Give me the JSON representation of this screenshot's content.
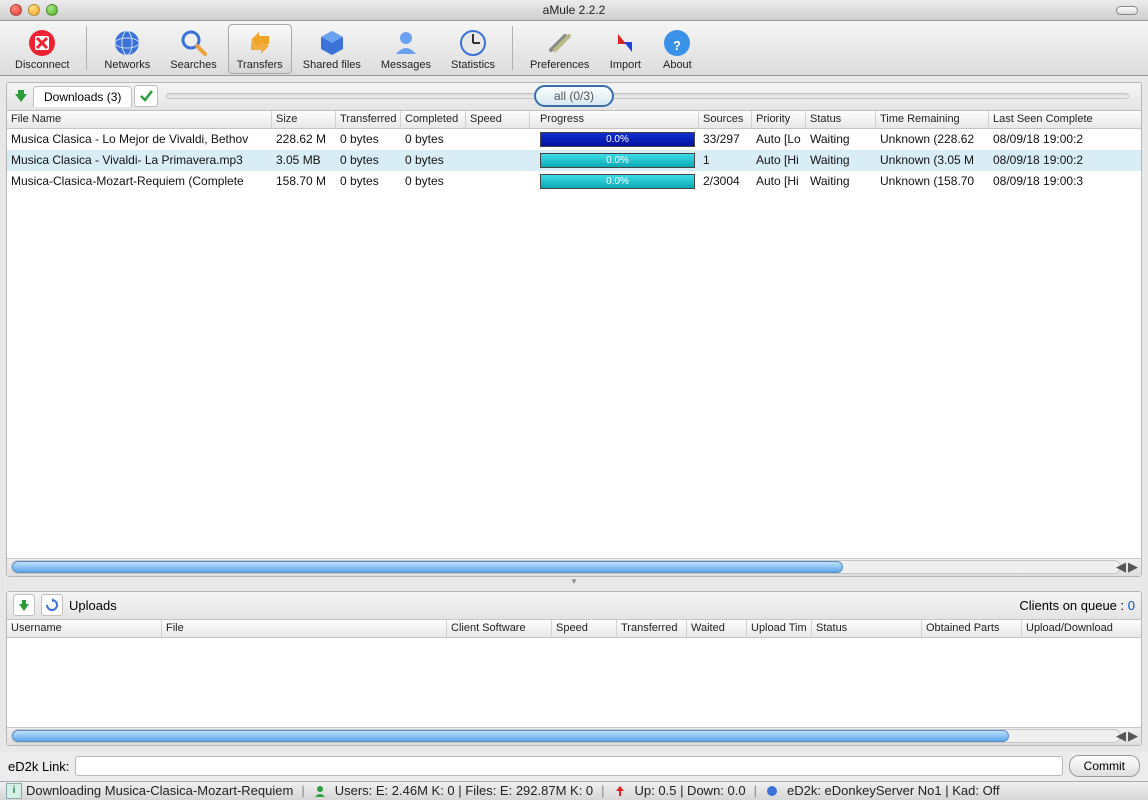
{
  "window": {
    "title": "aMule 2.2.2"
  },
  "toolbar": {
    "disconnect": "Disconnect",
    "networks": "Networks",
    "searches": "Searches",
    "transfers": "Transfers",
    "shared": "Shared files",
    "messages": "Messages",
    "statistics": "Statistics",
    "preferences": "Preferences",
    "import": "Import",
    "about": "About"
  },
  "downloads": {
    "tab_label": "Downloads (3)",
    "filter_pill": "all (0/3)",
    "columns": [
      "File Name",
      "Size",
      "Transferred",
      "Completed",
      "Speed",
      "Progress",
      "Sources",
      "Priority",
      "Status",
      "Time Remaining",
      "Last Seen Complete"
    ],
    "rows": [
      {
        "file": "Musica Clasica - Lo Mejor de Vivaldi, Bethov",
        "size": "228.62 M",
        "transferred": "0 bytes",
        "completed": "0 bytes",
        "speed": "",
        "progress": "0.0%",
        "ptype": "blue",
        "sources": "33/297",
        "priority": "Auto [Lo",
        "status": "Waiting",
        "remaining": "Unknown (228.62",
        "lastseen": "08/09/18 19:00:2"
      },
      {
        "file": "Musica Clasica - Vivaldi- La Primavera.mp3",
        "size": "3.05 MB",
        "transferred": "0 bytes",
        "completed": "0 bytes",
        "speed": "",
        "progress": "0.0%",
        "ptype": "cyan",
        "sources": "1",
        "priority": "Auto [Hi",
        "status": "Waiting",
        "remaining": "Unknown (3.05 M",
        "lastseen": "08/09/18 19:00:2",
        "selected": true
      },
      {
        "file": "Musica-Clasica-Mozart-Requiem (Complete",
        "size": "158.70 M",
        "transferred": "0 bytes",
        "completed": "0 bytes",
        "speed": "",
        "progress": "0.0%",
        "ptype": "cyan",
        "sources": "2/3004",
        "priority": "Auto [Hi",
        "status": "Waiting",
        "remaining": "Unknown (158.70",
        "lastseen": "08/09/18 19:00:3"
      }
    ]
  },
  "uploads": {
    "title": "Uploads",
    "queue_label": "Clients on queue :",
    "queue_count": "0",
    "columns": [
      "Username",
      "File",
      "Client Software",
      "Speed",
      "Transferred",
      "Waited",
      "Upload Tim",
      "Status",
      "Obtained Parts",
      "Upload/Download"
    ]
  },
  "link": {
    "label": "eD2k Link:",
    "value": "",
    "commit": "Commit"
  },
  "status": {
    "download_msg": "Downloading Musica-Clasica-Mozart-Requiem",
    "users": "Users: E: 2.46M K: 0 | Files: E: 292.87M K: 0",
    "speeds": "Up: 0.5 | Down: 0.0",
    "conn": "eD2k: eDonkeyServer No1 | Kad: Off"
  }
}
